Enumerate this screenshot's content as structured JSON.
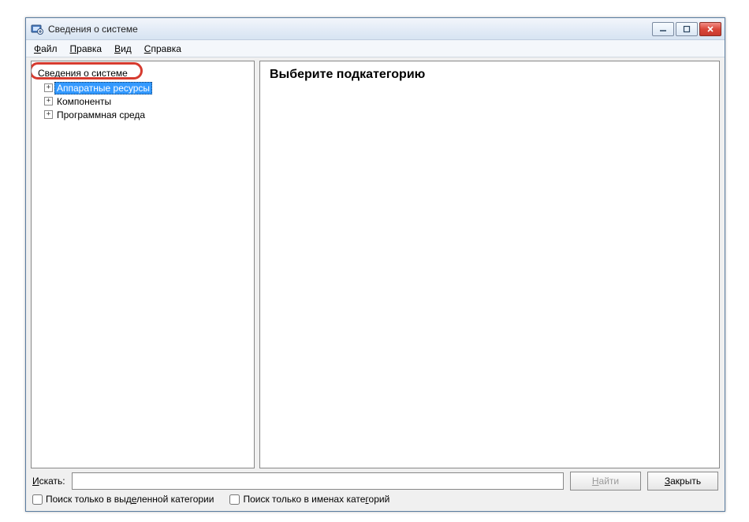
{
  "window": {
    "title": "Сведения о системе"
  },
  "menu": {
    "file": {
      "label": "Файл",
      "accel_index": 0
    },
    "edit": {
      "label": "Правка",
      "accel_index": 0
    },
    "view": {
      "label": "Вид",
      "accel_index": 0
    },
    "help": {
      "label": "Справка",
      "accel_index": 0
    }
  },
  "tree": {
    "root": "Сведения о системе",
    "items": [
      {
        "label": "Аппаратные ресурсы",
        "selected": true
      },
      {
        "label": "Компоненты",
        "selected": false
      },
      {
        "label": "Программная среда",
        "selected": false
      }
    ]
  },
  "content": {
    "heading": "Выберите подкатегорию"
  },
  "search": {
    "label": "Искать:",
    "accel_index": 0,
    "value": "",
    "find_label": "Найти",
    "find_accel_index": 0,
    "close_label": "Закрыть",
    "close_accel_index": 0
  },
  "checks": {
    "selected_category": "Поиск только в выделенной категории",
    "selected_category_accel_index": 18,
    "category_names": "Поиск только в именах категорий",
    "category_names_accel_index": 26
  }
}
